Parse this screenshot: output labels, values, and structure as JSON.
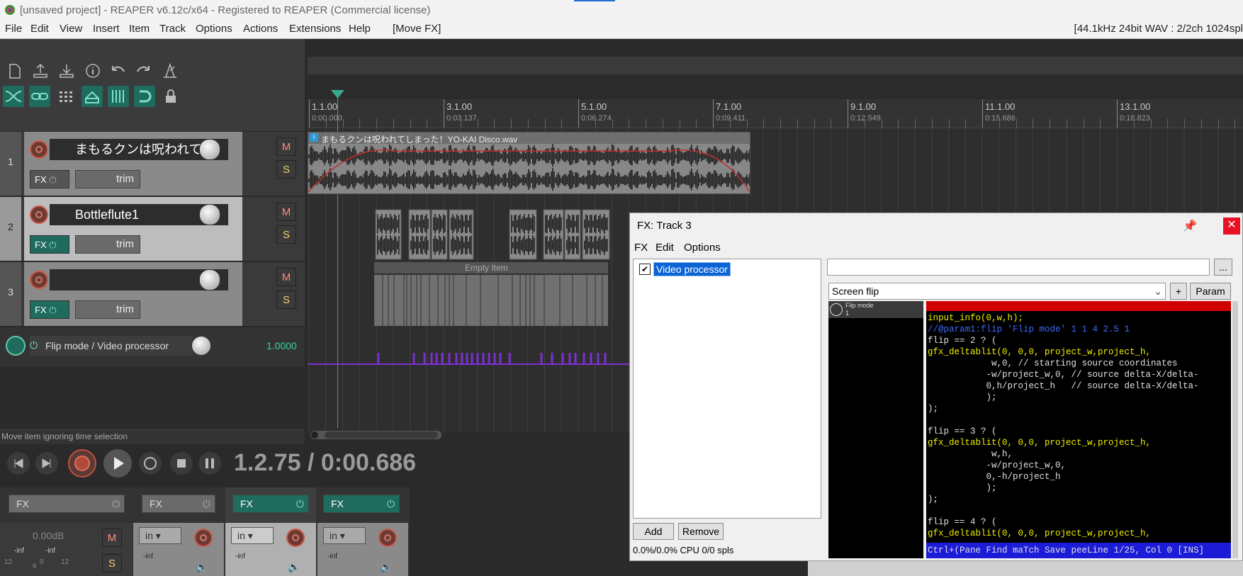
{
  "window": {
    "title": "[unsaved project] - REAPER v6.12c/x64 - Registered to REAPER (Commercial license)"
  },
  "menu": {
    "items": [
      "File",
      "Edit",
      "View",
      "Insert",
      "Item",
      "Track",
      "Options",
      "Actions",
      "Extensions",
      "Help"
    ],
    "last_action": "[Move FX]",
    "format": "[44.1kHz 24bit WAV : 2/2ch 1024spl"
  },
  "ruler": {
    "marks": [
      {
        "bar": "1.1.00",
        "time": "0:00.000"
      },
      {
        "bar": "3.1.00",
        "time": "0:03.137"
      },
      {
        "bar": "5.1.00",
        "time": "0:06.274"
      },
      {
        "bar": "7.1.00",
        "time": "0:09.411"
      },
      {
        "bar": "9.1.00",
        "time": "0:12.549"
      },
      {
        "bar": "11.1.00",
        "time": "0:15.686"
      },
      {
        "bar": "13.1.00",
        "time": "0:18.823"
      }
    ]
  },
  "tracks": [
    {
      "num": "1",
      "name": "まもるクンは呪われて",
      "fx": "FX",
      "trim": "trim",
      "mute": "M",
      "solo": "S"
    },
    {
      "num": "2",
      "name": "Bottleflute1",
      "fx": "FX",
      "trim": "trim",
      "mute": "M",
      "solo": "S"
    },
    {
      "num": "3",
      "name": "",
      "fx": "FX",
      "trim": "trim",
      "mute": "M",
      "solo": "S"
    }
  ],
  "items": {
    "track1_name": "まもるクンは呪われてしまった！YO-KAI Disco.wav",
    "empty_item": "Empty Item"
  },
  "envelope": {
    "label": "Flip mode / Video processor",
    "value": "1.0000"
  },
  "status": {
    "hint": "Move item ignoring time selection"
  },
  "transport": {
    "position": "1.2.75 / 0:00.686"
  },
  "mixer": {
    "fx_labels": [
      "FX",
      "FX",
      "FX",
      "FX"
    ],
    "master_volume": "0.00dB",
    "meter_labels": [
      "-inf",
      "-inf"
    ],
    "meter_scale": [
      "12",
      "6",
      "0",
      "12"
    ],
    "input_labels": [
      "in",
      "in",
      "in"
    ],
    "mute": "M",
    "solo": "S"
  },
  "fx_window": {
    "title": "FX: Track 3",
    "menu": [
      "FX",
      "Edit",
      "Options"
    ],
    "chain": [
      {
        "name": "Video processor",
        "enabled": true
      }
    ],
    "add_label": "Add",
    "remove_label": "Remove",
    "cpu": "0.0%/0.0% CPU 0/0 spls",
    "preset": "Screen flip",
    "browse_label": "...",
    "plus_label": "+",
    "param_label": "Param",
    "param_name": "Flip mode",
    "param_value": "1",
    "code_lines": [
      {
        "t": "input_info(0,w,h);",
        "c": "y"
      },
      {
        "t": "//@param1:flip 'Flip mode' 1 1 4 2.5 1",
        "c": "b"
      },
      {
        "t": "flip == 2 ? (",
        "c": "w"
      },
      {
        "t": "gfx_deltablit(0, 0,0, project_w,project_h,",
        "c": "y"
      },
      {
        "t": "            w,0, // starting source coordinates",
        "c": "w"
      },
      {
        "t": "           -w/project_w,0, // source delta-X/delta-",
        "c": "w"
      },
      {
        "t": "           0,h/project_h   // source delta-X/delta-",
        "c": "w"
      },
      {
        "t": "           );",
        "c": "w"
      },
      {
        "t": ");",
        "c": "w"
      },
      {
        "t": "",
        "c": "w"
      },
      {
        "t": "flip == 3 ? (",
        "c": "w"
      },
      {
        "t": "gfx_deltablit(0, 0,0, project_w,project_h,",
        "c": "y"
      },
      {
        "t": "            w,h,",
        "c": "w"
      },
      {
        "t": "           -w/project_w,0,",
        "c": "w"
      },
      {
        "t": "           0,-h/project_h",
        "c": "w"
      },
      {
        "t": "           );",
        "c": "w"
      },
      {
        "t": ");",
        "c": "w"
      },
      {
        "t": "",
        "c": "w"
      },
      {
        "t": "flip == 4 ? (",
        "c": "w"
      },
      {
        "t": "gfx_deltablit(0, 0,0, project_w,project_h,",
        "c": "y"
      }
    ],
    "code_status": "Ctrl+(Pane Find maTch Save peeLine 1/25, Col 0 [INS]"
  },
  "colors": {
    "accent": "#1f6b5e",
    "envelope": "#7a2fd0",
    "selection_blue": "#0a64d6",
    "close_red": "#e81123"
  }
}
